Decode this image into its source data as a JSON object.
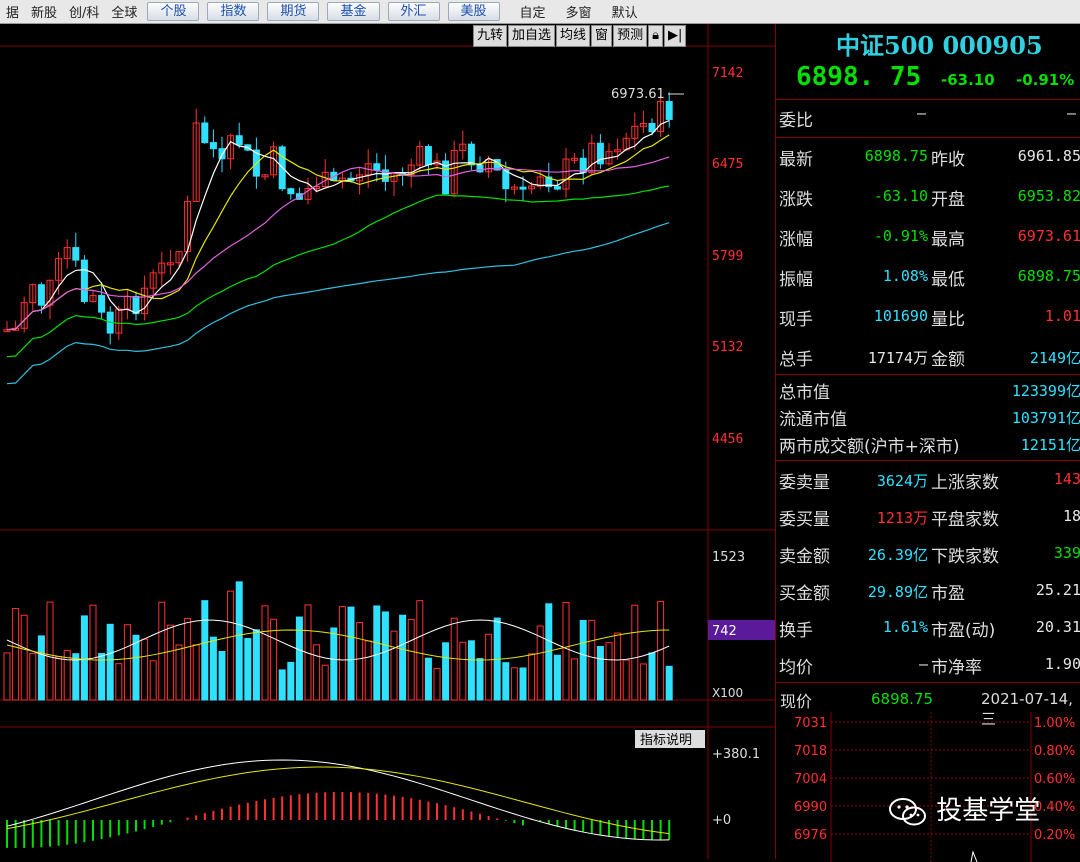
{
  "menu": {
    "left_items": [
      "据",
      "新股",
      "创/科",
      "全球"
    ],
    "buttons": [
      "个股",
      "指数",
      "期货",
      "基金",
      "外汇",
      "美股"
    ],
    "right_items": [
      "自定",
      "多窗",
      "默认"
    ]
  },
  "tools": [
    "九转",
    "加自选",
    "均线",
    "窗",
    "预测"
  ],
  "chart": {
    "price_ticks": [
      "7142",
      "6475",
      "5799",
      "5132",
      "4456"
    ],
    "high_label": "6973.61",
    "vol_ticks": [
      "1523",
      "742",
      "X100"
    ],
    "macd_tab": "指标说明",
    "macd_ticks": [
      "+380.1",
      "+0"
    ],
    "colors": {
      "up": "#ff3030",
      "down": "#30e0ff",
      "ma5": "#ffffff",
      "ma10": "#e6e600",
      "ma20": "#e060e0",
      "ma30": "#00e000",
      "ma60": "#30c0e0"
    }
  },
  "quote": {
    "title": "中证500 000905",
    "price": "6898. 75",
    "change": "-63.10",
    "pct": "-0.91%",
    "weibi_label": "委比",
    "weibi_v1": "–",
    "weibi_v2": "–",
    "grid": [
      {
        "l1": "最新",
        "v1": "6898.75",
        "c1": "g",
        "l2": "昨收",
        "v2": "6961.85",
        "c2": "w"
      },
      {
        "l1": "涨跌",
        "v1": "-63.10",
        "c1": "g",
        "l2": "开盘",
        "v2": "6953.82",
        "c2": "g"
      },
      {
        "l1": "涨幅",
        "v1": "-0.91%",
        "c1": "g",
        "l2": "最高",
        "v2": "6973.61",
        "c2": "r"
      },
      {
        "l1": "振幅",
        "v1": "1.08%",
        "c1": "c",
        "l2": "最低",
        "v2": "6898.75",
        "c2": "g"
      },
      {
        "l1": "现手",
        "v1": "101690",
        "c1": "c",
        "l2": "量比",
        "v2": "1.01",
        "c2": "r"
      },
      {
        "l1": "总手",
        "v1": "17174万",
        "c1": "w",
        "l2": "金额",
        "v2": "2149亿",
        "c2": "c"
      }
    ],
    "market": [
      {
        "l": "总市值",
        "v": "123399亿"
      },
      {
        "l": "流通市值",
        "v": "103791亿"
      },
      {
        "l": "两市成交额(沪市+深市)",
        "v": "12151亿"
      }
    ],
    "grid2": [
      {
        "l1": "委卖量",
        "v1": "3624万",
        "c1": "c",
        "l2": "上涨家数",
        "v2": "143",
        "c2": "r"
      },
      {
        "l1": "委买量",
        "v1": "1213万",
        "c1": "r",
        "l2": "平盘家数",
        "v2": "18",
        "c2": "w"
      },
      {
        "l1": "卖金额",
        "v1": "26.39亿",
        "c1": "c",
        "l2": "下跌家数",
        "v2": "339",
        "c2": "g"
      },
      {
        "l1": "买金额",
        "v1": "29.89亿",
        "c1": "c",
        "l2": "市盈",
        "v2": "25.21",
        "c2": "w"
      },
      {
        "l1": "换手",
        "v1": "1.61%",
        "c1": "c",
        "l2": "市盈(动)",
        "v2": "20.31",
        "c2": "w"
      },
      {
        "l1": "均价",
        "v1": "–",
        "c1": "w",
        "l2": "市净率",
        "v2": "1.90",
        "c2": "w"
      }
    ],
    "now_label": "现价",
    "now_value": "6898.75",
    "date": "2021-07-14,三",
    "mini_left": [
      "7031",
      "7018",
      "7004",
      "6990",
      "6976"
    ],
    "mini_right": [
      "1.00%",
      "0.80%",
      "0.60%",
      "0.40%",
      "0.20%"
    ]
  },
  "watermark": "投基学堂"
}
